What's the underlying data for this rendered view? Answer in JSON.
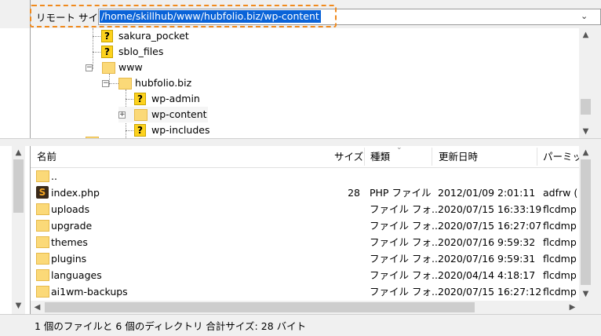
{
  "remote": {
    "label": "リモート サイト:",
    "path": "/home/skillhub/www/hubfolio.biz/wp-content"
  },
  "tree": {
    "items": [
      {
        "name": "sakura_pocket",
        "icon": "question-folder-icon"
      },
      {
        "name": "sblo_files",
        "icon": "question-folder-icon"
      },
      {
        "name": "www",
        "icon": "folder-icon"
      },
      {
        "name": "hubfolio.biz",
        "icon": "folder-icon"
      },
      {
        "name": "wp-admin",
        "icon": "question-folder-icon"
      },
      {
        "name": "wp-content",
        "icon": "folder-icon",
        "selected": true
      },
      {
        "name": "wp-includes",
        "icon": "question-folder-icon"
      }
    ]
  },
  "list": {
    "columns": [
      "名前",
      "サイズ",
      "種類",
      "更新日時",
      "パーミッシ"
    ],
    "rows": [
      {
        "name": "..",
        "size": "",
        "type": "",
        "modified": "",
        "perm": "",
        "icon": "folder-icon"
      },
      {
        "name": "index.php",
        "size": "28",
        "type": "PHP ファイル",
        "modified": "2012/01/09 2:01:11",
        "perm": "adfrw (",
        "icon": "php-file-icon"
      },
      {
        "name": "uploads",
        "size": "",
        "type": "ファイル フォ...",
        "modified": "2020/07/15 16:33:19",
        "perm": "flcdmp",
        "icon": "folder-icon"
      },
      {
        "name": "upgrade",
        "size": "",
        "type": "ファイル フォ...",
        "modified": "2020/07/15 16:27:07",
        "perm": "flcdmp",
        "icon": "folder-icon"
      },
      {
        "name": "themes",
        "size": "",
        "type": "ファイル フォ...",
        "modified": "2020/07/16 9:59:32",
        "perm": "flcdmp",
        "icon": "folder-icon"
      },
      {
        "name": "plugins",
        "size": "",
        "type": "ファイル フォ...",
        "modified": "2020/07/16 9:59:31",
        "perm": "flcdmp",
        "icon": "folder-icon"
      },
      {
        "name": "languages",
        "size": "",
        "type": "ファイル フォ...",
        "modified": "2020/04/14 4:18:17",
        "perm": "flcdmp",
        "icon": "folder-icon"
      },
      {
        "name": "ai1wm-backups",
        "size": "",
        "type": "ファイル フォ...",
        "modified": "2020/07/15 16:27:12",
        "perm": "flcdmp",
        "icon": "folder-icon"
      }
    ]
  },
  "status": "1 個のファイルと 6 個のディレクトリ 合計サイズ: 28 バイト",
  "colors": {
    "highlight": "#f08a1e",
    "selection": "#0a63d8",
    "folder": "#fbd978"
  }
}
